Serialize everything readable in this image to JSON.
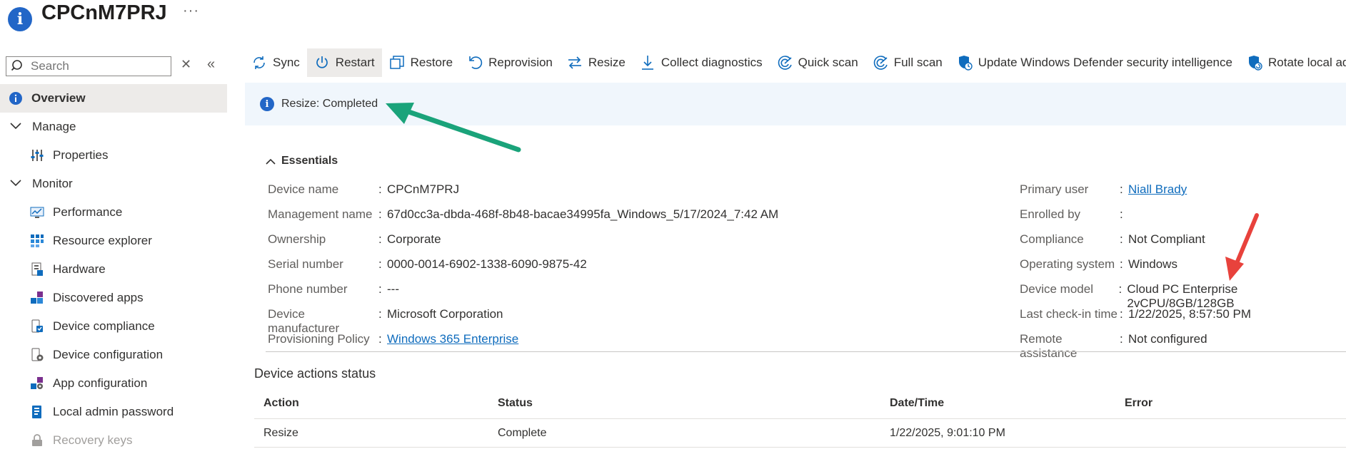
{
  "header": {
    "title": "CPCnM7PRJ",
    "more": "···"
  },
  "sidebar": {
    "search_placeholder": "Search",
    "close_glyph": "✕",
    "collapse_glyph": "«",
    "items": [
      {
        "label": "Overview",
        "icon": "info-icon"
      },
      {
        "label": "Manage",
        "icon": "chevron-down-icon"
      },
      {
        "label": "Properties",
        "icon": "properties-icon"
      },
      {
        "label": "Monitor",
        "icon": "chevron-down-icon"
      },
      {
        "label": "Performance",
        "icon": "performance-icon"
      },
      {
        "label": "Resource explorer",
        "icon": "resource-explorer-icon"
      },
      {
        "label": "Hardware",
        "icon": "hardware-icon"
      },
      {
        "label": "Discovered apps",
        "icon": "apps-icon"
      },
      {
        "label": "Device compliance",
        "icon": "compliance-icon"
      },
      {
        "label": "Device configuration",
        "icon": "configuration-icon"
      },
      {
        "label": "App configuration",
        "icon": "app-config-icon"
      },
      {
        "label": "Local admin password",
        "icon": "password-icon"
      },
      {
        "label": "Recovery keys",
        "icon": "lock-icon"
      }
    ]
  },
  "toolbar": {
    "sync": "Sync",
    "restart": "Restart",
    "restore": "Restore",
    "reprovision": "Reprovision",
    "resize": "Resize",
    "collect": "Collect diagnostics",
    "quick_scan": "Quick scan",
    "full_scan": "Full scan",
    "update_defender": "Update Windows Defender security intelligence",
    "rotate": "Rotate local admin passw"
  },
  "banner": {
    "text": "Resize: Completed"
  },
  "essentials": {
    "heading": "Essentials",
    "left": [
      {
        "label": "Device name",
        "value": "CPCnM7PRJ"
      },
      {
        "label": "Management name",
        "value": "67d0cc3a-dbda-468f-8b48-bacae34995fa_Windows_5/17/2024_7:42 AM"
      },
      {
        "label": "Ownership",
        "value": "Corporate"
      },
      {
        "label": "Serial number",
        "value": "0000-0014-6902-1338-6090-9875-42"
      },
      {
        "label": "Phone number",
        "value": "---"
      },
      {
        "label": "Device manufacturer",
        "value": "Microsoft Corporation"
      },
      {
        "label": "Provisioning Policy",
        "value": "Windows 365 Enterprise"
      }
    ],
    "right": [
      {
        "label": "Primary user",
        "value": "Niall Brady"
      },
      {
        "label": "Enrolled by",
        "value": ""
      },
      {
        "label": "Compliance",
        "value": "Not Compliant"
      },
      {
        "label": "Operating system",
        "value": "Windows"
      },
      {
        "label": "Device model",
        "value": "Cloud PC Enterprise 2vCPU/8GB/128GB"
      },
      {
        "label": "Last check-in time",
        "value": "1/22/2025, 8:57:50 PM"
      },
      {
        "label": "Remote assistance",
        "value": "Not configured"
      }
    ],
    "colon": ":"
  },
  "actions": {
    "title": "Device actions status",
    "columns": [
      "Action",
      "Status",
      "Date/Time",
      "Error"
    ],
    "rows": [
      [
        "Resize",
        "Complete",
        "1/22/2025, 9:01:10 PM",
        ""
      ]
    ]
  },
  "colors": {
    "accent": "#0f6cbd",
    "banner_bg": "#f0f6fc",
    "arrow_green": "#1aa37a",
    "arrow_red": "#e8423c"
  }
}
